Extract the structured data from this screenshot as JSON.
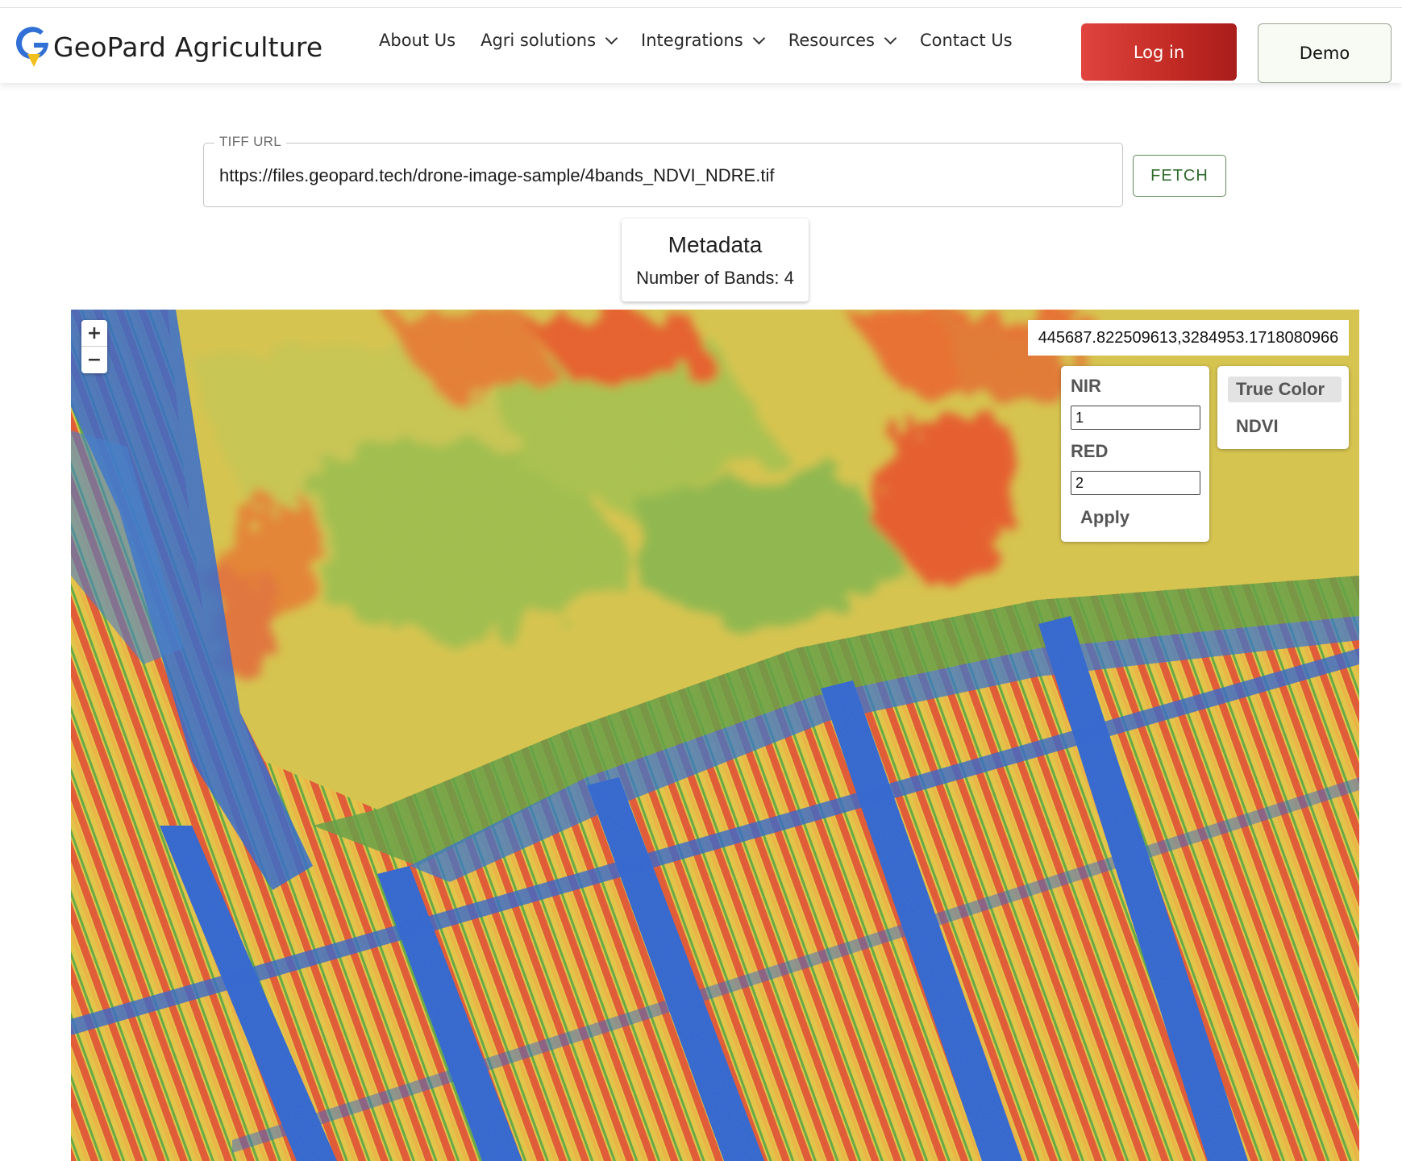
{
  "header": {
    "brand": "GeoPard Agriculture",
    "nav": [
      "About Us",
      "Agri solutions",
      "Integrations",
      "Resources",
      "Contact Us"
    ],
    "nav_has_dropdown": [
      false,
      true,
      true,
      true,
      false
    ],
    "login_label": "Log in",
    "demo_label": "Demo",
    "colors": {
      "login_start": "#e0443e",
      "login_end": "#a91d1a",
      "logo_blue": "#2f6fd6",
      "logo_yellow": "#f2c01e"
    }
  },
  "tiff": {
    "label": "TIFF URL",
    "url": "https://files.geopard.tech/drone-image-sample/4bands_NDVI_NDRE.tif",
    "fetch_label": "FETCH"
  },
  "metadata": {
    "title": "Metadata",
    "bands_text": "Number of Bands: 4"
  },
  "map": {
    "coordinates": "445687.822509613,3284953.1718080966",
    "zoom_in": "+",
    "zoom_out": "−",
    "bands": {
      "nir_label": "NIR",
      "nir_value": "1",
      "red_label": "RED",
      "red_value": "2",
      "apply_label": "Apply"
    },
    "modes": {
      "true_color": "True Color",
      "ndvi": "NDVI",
      "selected": "True Color"
    },
    "palette": {
      "low": "#1f5fd1",
      "mid_low": "#4fa83a",
      "mid": "#e4c43a",
      "high": "#e85a22"
    }
  }
}
